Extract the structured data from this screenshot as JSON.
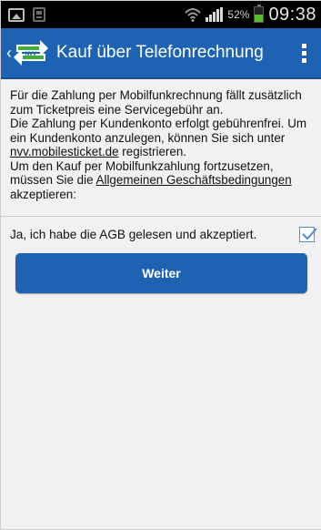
{
  "status_bar": {
    "battery_percent": "52%",
    "battery_level": 0.52,
    "time": "09:38",
    "icons": [
      "image-icon",
      "photo-icon",
      "wifi-icon",
      "signal-icon",
      "battery-icon"
    ]
  },
  "action_bar": {
    "title": "Kauf über Telefonrechnung",
    "logo_text": "NVV",
    "accent_color": "#1e63b3"
  },
  "info": {
    "line1": "Für die Zahlung per Mobilfunkrechnung fällt zusätzlich zum Ticketpreis eine Servicegebühr an.",
    "line2": "Die Zahlung per Kundenkonto erfolgt gebührenfrei. Um ein Kundenkonto anzulegen, können Sie sich unter",
    "link_site": "nvv.mobilesticket.de",
    "line3": " registrieren.",
    "line4": "Um den Kauf per Mobilfunkzahlung fortzusetzen, müssen Sie die ",
    "link_agb": "Allgemeinen Geschäftsbedingungen",
    "line5": "akzeptieren:"
  },
  "agb": {
    "label": "Ja, ich habe die AGB gelesen und akzeptiert.",
    "checked": true
  },
  "weiter_button": {
    "label": "Weiter"
  }
}
